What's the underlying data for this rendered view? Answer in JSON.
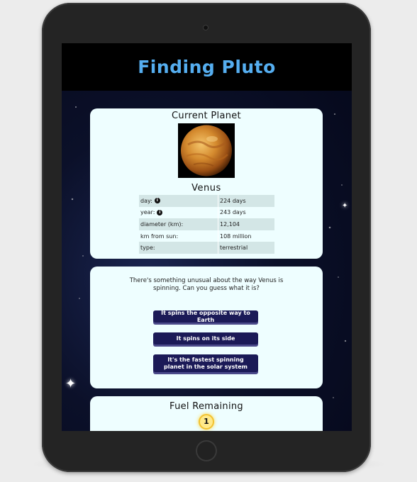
{
  "header": {
    "title": "Finding Pluto"
  },
  "planet_card": {
    "heading": "Current Planet",
    "planet_name": "Venus",
    "facts": [
      {
        "label": "day:",
        "value": "224 days",
        "has_info": true
      },
      {
        "label": "year:",
        "value": "243 days",
        "has_info": true
      },
      {
        "label": "diameter (km):",
        "value": "12,104",
        "has_info": false
      },
      {
        "label": "km from sun:",
        "value": "108 million",
        "has_info": false
      },
      {
        "label": "type:",
        "value": "terrestrial",
        "has_info": false
      }
    ],
    "info_icon": "info-icon"
  },
  "question_card": {
    "question": "There's something unusual about the way Venus is spinning. Can you guess what it is?",
    "answers": [
      "It spins the opposite way to Earth",
      "It spins on its side",
      "It's the fastest spinning planet in the solar system"
    ]
  },
  "fuel_card": {
    "heading": "Fuel Remaining",
    "fuel_count": "1"
  },
  "colors": {
    "title": "#55aef0",
    "card_bg": "#eefeff",
    "button_bg": "#1b1a57",
    "table_shade": "#d3e6e6"
  }
}
